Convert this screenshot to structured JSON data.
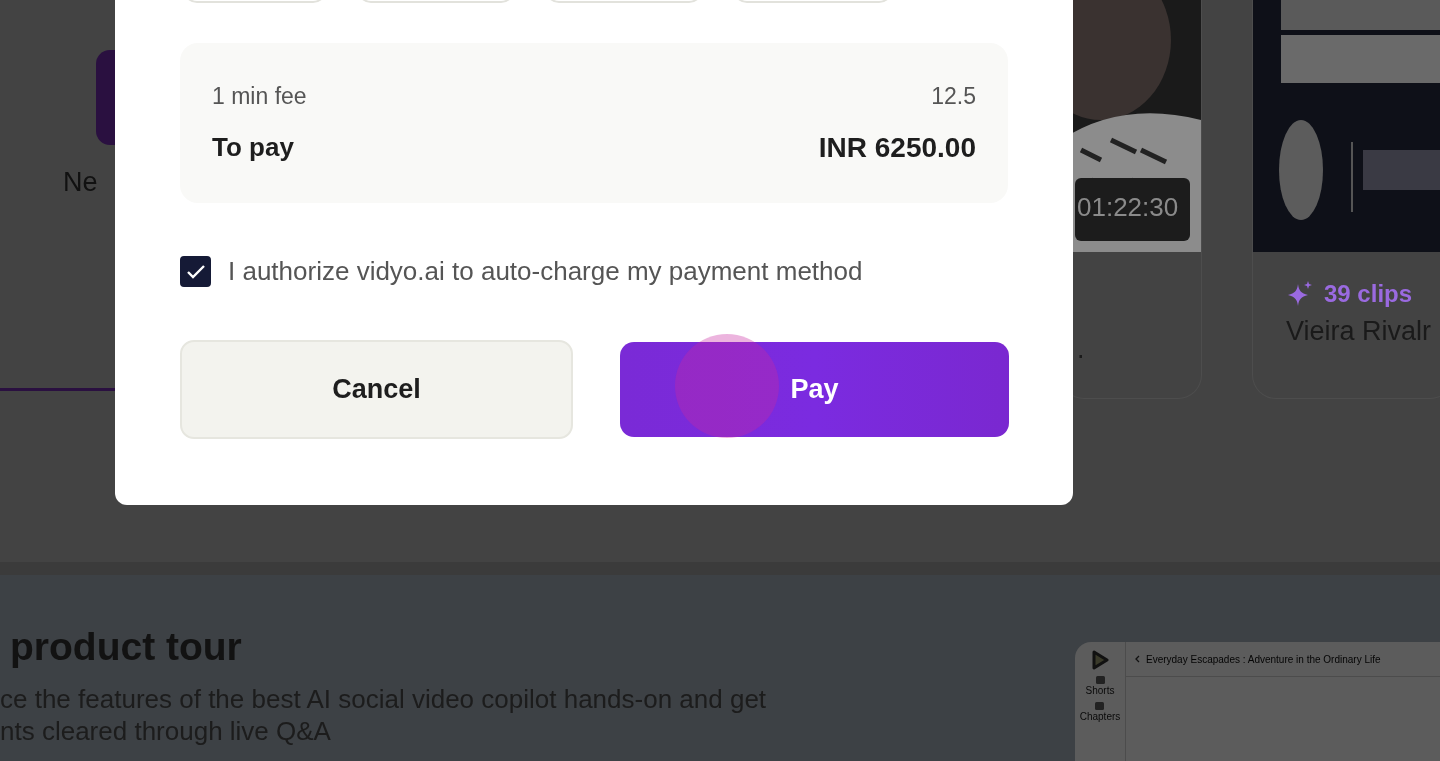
{
  "background": {
    "tile_label": "Ne",
    "videos": [
      {
        "duration": "01:22:30",
        "title": "."
      },
      {
        "clips": "39 clips",
        "title": "Vieira Rivalr"
      }
    ],
    "tour": {
      "heading": "product tour",
      "lines": [
        "ce the features of the best AI social video copilot hands-on and get",
        "nts cleared through live Q&A"
      ],
      "preview": {
        "title": "Everyday Escapades : Adventure in the Ordinary Life",
        "nav": [
          "Shorts",
          "Chapters"
        ]
      }
    }
  },
  "dialog": {
    "fee_label": "1 min fee",
    "fee_value": "12.5",
    "total_label": "To pay",
    "total_value": "INR 6250.00",
    "authorize": {
      "label": "I authorize vidyo.ai to auto-charge my payment method",
      "checked": true
    },
    "buttons": [
      {
        "kind": "secondary",
        "label": "Cancel"
      },
      {
        "kind": "primary",
        "label": "Pay"
      }
    ]
  }
}
